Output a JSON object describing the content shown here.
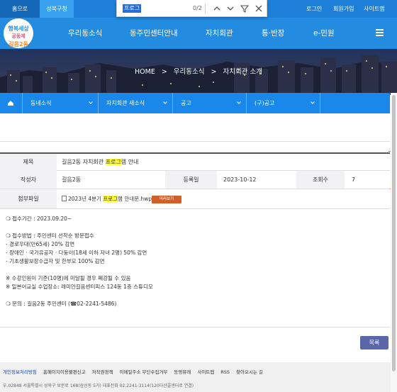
{
  "topbar": {
    "tabs": [
      "홈으로",
      "성북구청"
    ],
    "links": [
      "로그인",
      "회원가입",
      "사이트맵"
    ]
  },
  "findbar": {
    "query": "프로그",
    "count": "0/2",
    "icons": [
      "chevron-up-icon",
      "chevron-down-icon",
      "filter-icon",
      "close-icon"
    ]
  },
  "nav": {
    "logo_lines": [
      "행복세상",
      "공동체",
      "길음2동"
    ],
    "items": [
      "우리동소식",
      "동주민센터안내",
      "자치회관",
      "통·반장",
      "e-민원"
    ],
    "menu_icon": "hamburger-icon"
  },
  "hero": {
    "breadcrumb": [
      "HOME",
      ">",
      "우리동소식",
      ">",
      "자치회관 소개"
    ]
  },
  "subnav": {
    "items": [
      "동네소식",
      "자치회관 새소식",
      "공고",
      "(구)공고"
    ]
  },
  "post": {
    "title_label": "제목",
    "title_before": "길음2동 자치회관 ",
    "title_highlight": "프로그",
    "title_after": "램 안내",
    "author_label": "작성자",
    "author": "길음2동",
    "date_label": "등록일",
    "date": "2023-10-12",
    "views_label": "조회수",
    "views": "7",
    "attach_label": "첨부파일",
    "attach_before": "2023년 4분기 ",
    "attach_highlight": "프로그",
    "attach_after": "램 안내문.hwp",
    "preview_label": "미리보기"
  },
  "content": {
    "lines": [
      "❍ 접수기간 : 2023.09.20~",
      "",
      "❍ 접수방법 : 주민센터 선착순 방문접수",
      " - 경로우대(만65세) 20% 감면",
      " - 장애인 · 국가유공자 · 다둥이(18세 이하 자녀 2명) 50% 감면",
      " - 기초생활보장수급자 및 한부모 100% 감면",
      "",
      "※ 수강인원이 기준(10명)에 미달될 경우 폐강될 수 있음",
      "※ 일본어교실 수업장소: 래미안길음센터피스 124동 1층 스튜디오",
      "",
      "❍ 문의 : 길음2동 주민센터 (☎02-2241-5486)"
    ]
  },
  "list_button": "목록",
  "footer": {
    "links": [
      "개인정보처리방침",
      "홈페이지이용불편신고",
      "저작권정책",
      "이메일주소 무단수집거부",
      "동영뮤레",
      "사이트맵",
      "RSS",
      "찾아오시는 길"
    ],
    "address": "우.02848 서울특별시 성북구 보문로 168(삼선동 5가) 대표전화 02.2241-3114(120다산콜센터로 연결)"
  },
  "colors": {
    "topbar": "#1d7fd8",
    "navbar": "#238ce1",
    "subnav": "#1a87ea",
    "highlight": "#ffff33",
    "preview_button": "#d0602a",
    "list_button": "#5a66a8"
  }
}
